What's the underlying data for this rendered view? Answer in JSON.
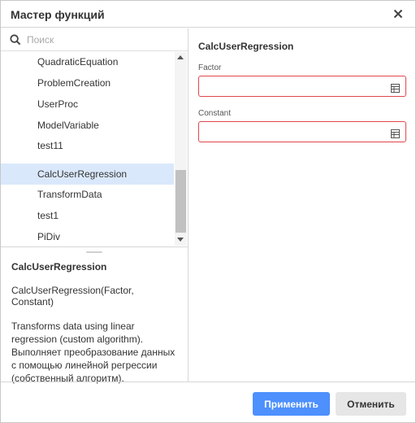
{
  "dialog": {
    "title": "Мастер функций",
    "colors": {
      "accent": "#4d90fe",
      "selected_row": "#dae8fb",
      "field_border_error": "#e0474c"
    }
  },
  "search": {
    "placeholder": "Поиск",
    "value": ""
  },
  "list": {
    "items": [
      {
        "label": "QuadraticEquation",
        "selected": false
      },
      {
        "label": "ProblemCreation",
        "selected": false
      },
      {
        "label": "UserProc",
        "selected": false
      },
      {
        "label": "ModelVariable",
        "selected": false
      },
      {
        "label": "test11",
        "selected": false
      },
      {
        "label": "CalcUserRegression",
        "selected": true
      },
      {
        "label": "TransformData",
        "selected": false
      },
      {
        "label": "test1",
        "selected": false
      },
      {
        "label": "PiDiv",
        "selected": false
      }
    ]
  },
  "description": {
    "title": "CalcUserRegression",
    "signature": "CalcUserRegression(Factor, Constant)",
    "text": "Transforms data using linear regression (custom algorithm). Выполняет преобразование данных с помощью линейной регрессии (собственный алгоритм)."
  },
  "editor": {
    "function_name": "CalcUserRegression",
    "params": [
      {
        "label": "Factor",
        "value": ""
      },
      {
        "label": "Constant",
        "value": ""
      }
    ]
  },
  "footer": {
    "apply_label": "Применить",
    "cancel_label": "Отменить"
  },
  "icons": {
    "close": "close-icon",
    "search": "search-icon",
    "table": "table-icon",
    "scroll_up": "chevron-up-icon",
    "scroll_down": "chevron-down-icon"
  }
}
